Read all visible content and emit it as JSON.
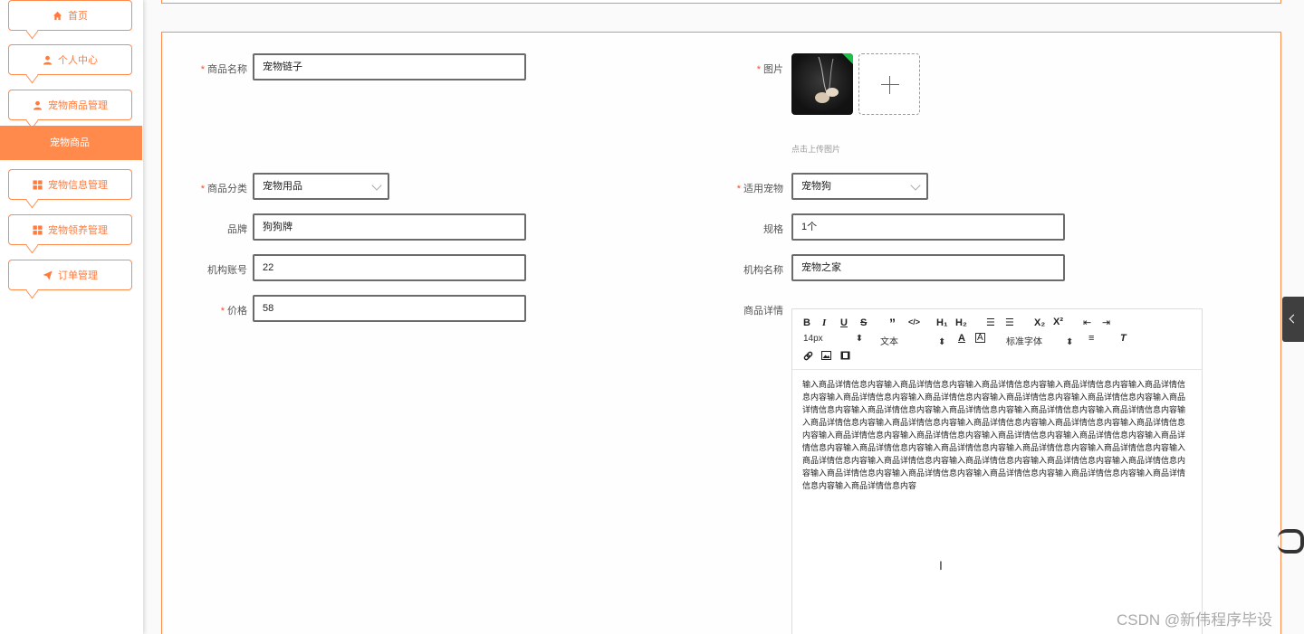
{
  "sidebar": {
    "items": [
      {
        "label": "首页",
        "icon": "home-icon"
      },
      {
        "label": "个人中心",
        "icon": "user-icon"
      },
      {
        "label": "宠物商品管理",
        "icon": "user-icon"
      },
      {
        "label": "宠物信息管理",
        "icon": "grid-icon"
      },
      {
        "label": "宠物领养管理",
        "icon": "grid-icon"
      },
      {
        "label": "订单管理",
        "icon": "send-icon"
      }
    ],
    "active_label": "宠物商品"
  },
  "form": {
    "name_label": "商品名称",
    "name_value": "宠物链子",
    "image_label": "图片",
    "upload_hint": "点击上传图片",
    "category_label": "商品分类",
    "category_value": "宠物用品",
    "pet_label": "适用宠物",
    "pet_value": "宠物狗",
    "brand_label": "品牌",
    "brand_value": "狗狗牌",
    "spec_label": "规格",
    "spec_value": "1个",
    "account_label": "机构账号",
    "account_value": "22",
    "org_label": "机构名称",
    "org_value": "宠物之家",
    "price_label": "价格",
    "price_value": "58",
    "detail_label": "商品详情"
  },
  "editor": {
    "font_size": "14px",
    "block_type": "文本",
    "font_family": "标准字体",
    "content": "输入商品详情信息内容输入商品详情信息内容输入商品详情信息内容输入商品详情信息内容输入商品详情信息内容输入商品详情信息内容输入商品详情信息内容输入商品详情信息内容输入商品详情信息内容输入商品详情信息内容输入商品详情信息内容输入商品详情信息内容输入商品详情信息内容输入商品详情信息内容输入商品详情信息内容输入商品详情信息内容输入商品详情信息内容输入商品详情信息内容输入商品详情信息内容输入商品详情信息内容输入商品详情信息内容输入商品详情信息内容输入商品详情信息内容输入商品详情信息内容输入商品详情信息内容输入商品详情信息内容输入商品详情信息内容输入商品详情信息内容输入商品详情信息内容输入商品详情信息内容输入商品详情信息内容输入商品详情信息内容输入商品详情信息内容输入商品详情信息内容输入商品详情信息内容输入商品详情信息内容输入商品详情信息内容输入商品详情信息内容输入商品详情信息内容"
  },
  "watermark": "CSDN @新伟程序毕设",
  "colors": {
    "accent": "#ff8a4c",
    "required": "#ff4a2a"
  }
}
